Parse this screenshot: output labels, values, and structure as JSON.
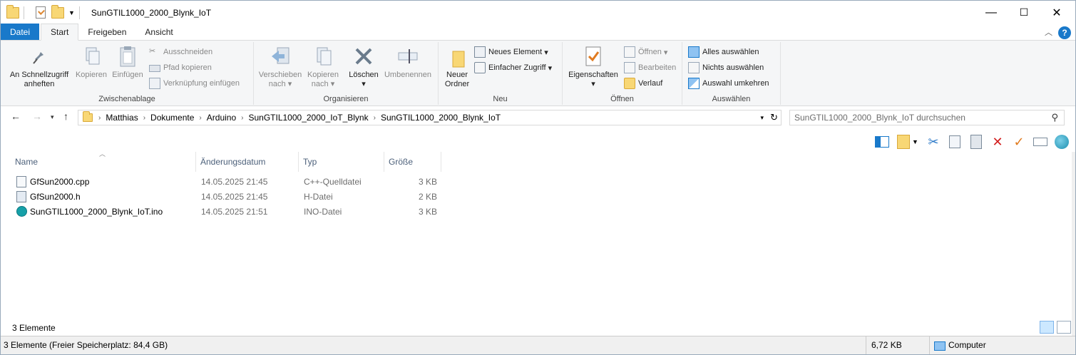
{
  "window": {
    "title": "SunGTIL1000_2000_Blynk_IoT",
    "minimize": "—",
    "maximize": "☐",
    "close": "✕"
  },
  "tabs": [
    "Datei",
    "Start",
    "Freigeben",
    "Ansicht"
  ],
  "ribbon": {
    "clipboard": {
      "label": "Zwischenablage",
      "pin": "An Schnellzugriff anheften",
      "copy": "Kopieren",
      "paste": "Einfügen",
      "cut": "Ausschneiden",
      "copy_path": "Pfad kopieren",
      "paste_shortcut": "Verknüpfung einfügen"
    },
    "organize": {
      "label": "Organisieren",
      "move": "Verschieben nach",
      "copy_to": "Kopieren nach",
      "delete": "Löschen",
      "rename": "Umbenennen"
    },
    "new": {
      "label": "Neu",
      "new_folder": "Neuer Ordner",
      "new_item": "Neues Element",
      "easy_access": "Einfacher Zugriff"
    },
    "open": {
      "label": "Öffnen",
      "properties": "Eigenschaften",
      "open": "Öffnen",
      "edit": "Bearbeiten",
      "history": "Verlauf"
    },
    "select": {
      "label": "Auswählen",
      "all": "Alles auswählen",
      "none": "Nichts auswählen",
      "invert": "Auswahl umkehren"
    }
  },
  "address": {
    "crumbs": [
      "Matthias",
      "Dokumente",
      "Arduino",
      "SunGTIL1000_2000_IoT_Blynk",
      "SunGTIL1000_2000_Blynk_IoT"
    ],
    "search_placeholder": "SunGTIL1000_2000_Blynk_IoT durchsuchen"
  },
  "columns": [
    "Name",
    "Änderungsdatum",
    "Typ",
    "Größe"
  ],
  "files": [
    {
      "name": "GfSun2000.cpp",
      "date": "14.05.2025 21:45",
      "type": "C++-Quelldatei",
      "size": "3 KB"
    },
    {
      "name": "GfSun2000.h",
      "date": "14.05.2025 21:45",
      "type": "H-Datei",
      "size": "2 KB"
    },
    {
      "name": "SunGTIL1000_2000_Blynk_IoT.ino",
      "date": "14.05.2025 21:51",
      "type": "INO-Datei",
      "size": "3 KB"
    }
  ],
  "status": {
    "count": "3 Elemente",
    "bottom_left": "3 Elemente (Freier Speicherplatz: 84,4 GB)",
    "size": "6,72 KB",
    "computer": "Computer"
  },
  "colors": {
    "accent": "#1979ca",
    "delete_red": "#d21f1f",
    "check_orange": "#e07a1f"
  }
}
